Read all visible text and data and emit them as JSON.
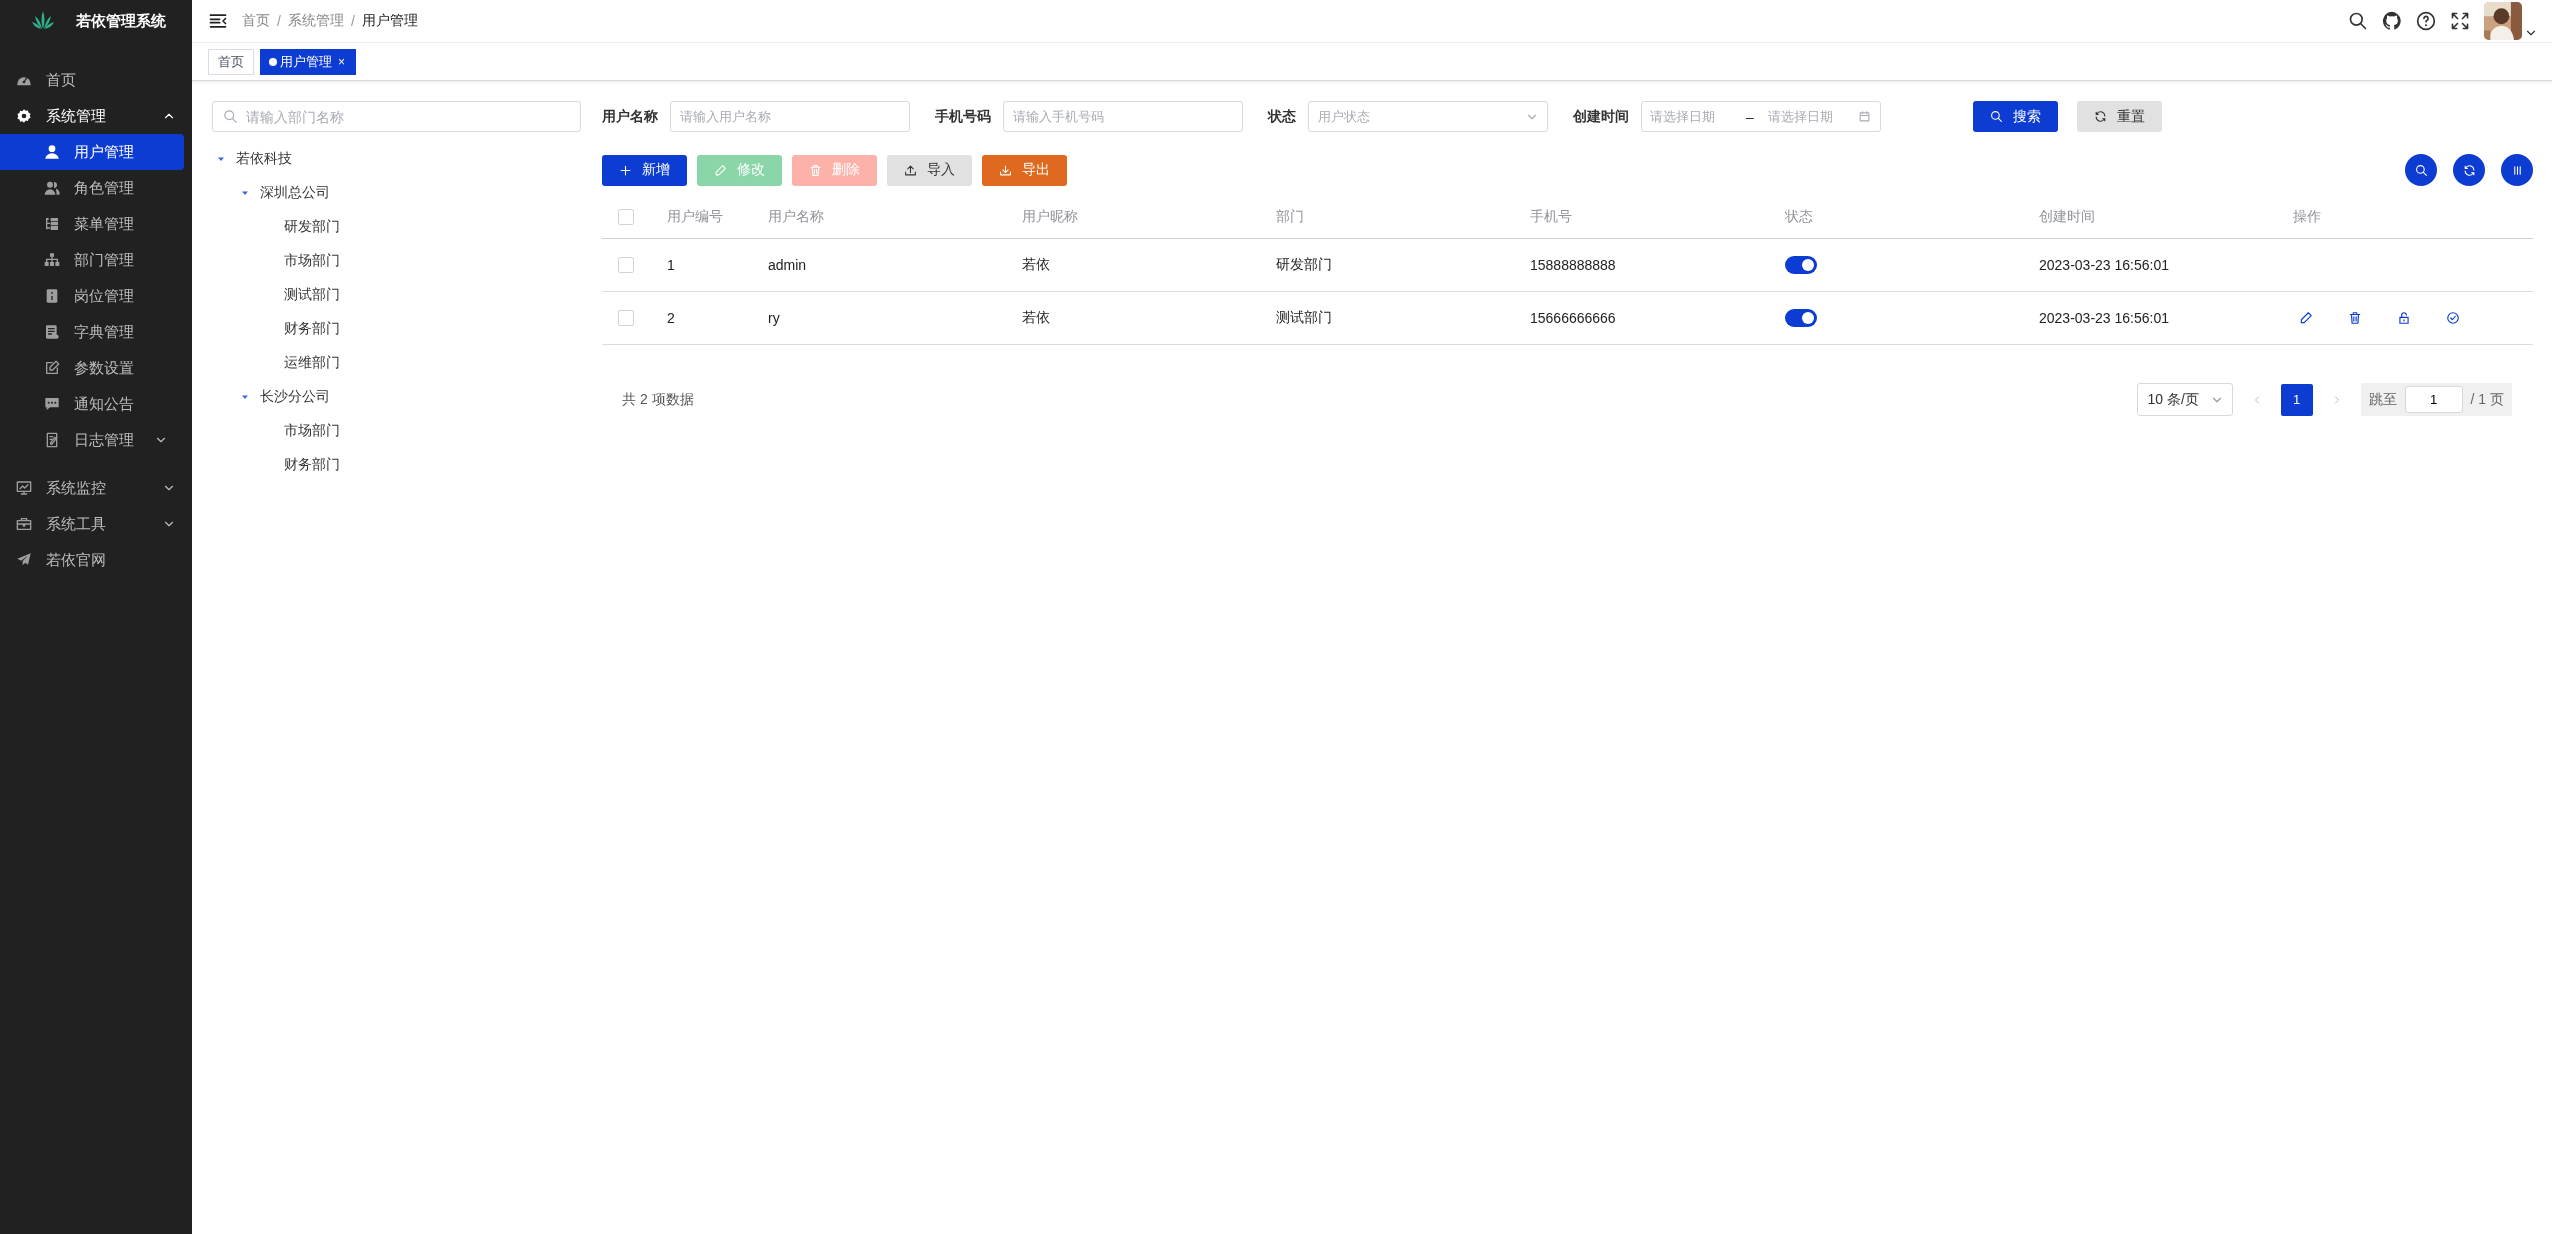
{
  "app": {
    "title": "若依管理系统"
  },
  "sidebar": {
    "items": [
      {
        "label": "首页",
        "selected": false
      },
      {
        "label": "系统管理",
        "selected": false,
        "expanded": true,
        "children": [
          {
            "label": "用户管理",
            "selected": true
          },
          {
            "label": "角色管理",
            "selected": false
          },
          {
            "label": "菜单管理",
            "selected": false
          },
          {
            "label": "部门管理",
            "selected": false
          },
          {
            "label": "岗位管理",
            "selected": false
          },
          {
            "label": "字典管理",
            "selected": false
          },
          {
            "label": "参数设置",
            "selected": false
          },
          {
            "label": "通知公告",
            "selected": false
          },
          {
            "label": "日志管理",
            "selected": false,
            "expanded": false
          }
        ]
      },
      {
        "label": "系统监控",
        "selected": false,
        "expanded": false
      },
      {
        "label": "系统工具",
        "selected": false,
        "expanded": false
      },
      {
        "label": "若依官网",
        "selected": false
      }
    ]
  },
  "breadcrumb": {
    "separator": "/",
    "items": [
      "首页",
      "系统管理",
      "用户管理"
    ]
  },
  "tabs": [
    {
      "label": "首页",
      "selected": false
    },
    {
      "label": "用户管理",
      "selected": true,
      "close": "×"
    }
  ],
  "dept_tree": {
    "search": {
      "placeholder": "请输入部门名称"
    },
    "nodes": [
      {
        "label": "若依科技",
        "expanded": true,
        "children": [
          {
            "label": "深圳总公司",
            "expanded": true,
            "children": [
              {
                "label": "研发部门"
              },
              {
                "label": "市场部门"
              },
              {
                "label": "测试部门"
              },
              {
                "label": "财务部门"
              },
              {
                "label": "运维部门"
              }
            ]
          },
          {
            "label": "长沙分公司",
            "expanded": true,
            "children": [
              {
                "label": "市场部门"
              },
              {
                "label": "财务部门"
              }
            ]
          }
        ]
      }
    ]
  },
  "filters": [
    {
      "kind": "text",
      "label": "用户名称",
      "placeholder": "请输入用户名称"
    },
    {
      "kind": "text",
      "label": "手机号码",
      "placeholder": "请输入手机号码"
    },
    {
      "kind": "select",
      "label": "状态",
      "placeholder": "用户状态"
    },
    {
      "kind": "daterange",
      "label": "创建时间",
      "start_placeholder": "请选择日期",
      "separator": "–",
      "end_placeholder": "请选择日期"
    }
  ],
  "filter_buttons": [
    {
      "kind": "primary",
      "label": "搜索"
    },
    {
      "kind": "plain",
      "label": "重置"
    }
  ],
  "toolbar": [
    {
      "kind": "primary",
      "label": "新增",
      "disabled": false
    },
    {
      "kind": "success",
      "label": "修改",
      "disabled": true
    },
    {
      "kind": "danger",
      "label": "删除",
      "disabled": true
    },
    {
      "kind": "info",
      "label": "导入",
      "disabled": false
    },
    {
      "kind": "warning",
      "label": "导出",
      "disabled": false
    }
  ],
  "table": {
    "select_all_checked": false,
    "columns": [
      "用户编号",
      "用户名称",
      "用户昵称",
      "部门",
      "手机号",
      "状态",
      "创建时间",
      "操作"
    ],
    "rows": [
      {
        "checked": false,
        "id": "1",
        "username": "admin",
        "nickname": "若依",
        "dept": "研发部门",
        "phone": "15888888888",
        "status_on": true,
        "created": "2023-03-23 16:56:01",
        "actions": false
      },
      {
        "checked": false,
        "id": "2",
        "username": "ry",
        "nickname": "若依",
        "dept": "测试部门",
        "phone": "15666666666",
        "status_on": true,
        "created": "2023-03-23 16:56:01",
        "actions": true
      }
    ]
  },
  "pagination": {
    "total": "共 2 项数据",
    "page_size": "10 条/页",
    "pages": [
      {
        "label": "1",
        "selected": true
      }
    ],
    "jump_label": "跳至",
    "jump_value": "1",
    "page_count": "/ 1 页"
  }
}
